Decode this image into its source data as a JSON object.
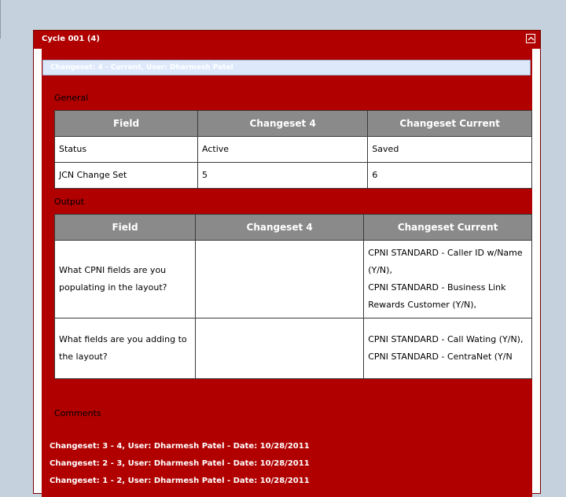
{
  "panel": {
    "title": "Cycle 001 (4)"
  },
  "changeset_bar": "Changeset: 4 - Current, User: Dharmesh Patel",
  "general": {
    "title": "General",
    "columns": [
      "Field",
      "Changeset 4",
      "Changeset Current"
    ],
    "rows": [
      [
        "Status",
        "Active",
        "Saved"
      ],
      [
        "JCN Change Set",
        "5",
        "6"
      ]
    ]
  },
  "output": {
    "title": "Output",
    "columns": [
      "Field",
      "Changeset 4",
      "Changeset Current"
    ],
    "rows": [
      {
        "field": "What CPNI fields are you populating in the layout?",
        "changeset4": "",
        "current": [
          "CPNI STANDARD - Caller ID w/Name (Y/N),",
          "CPNI STANDARD - Business Link Rewards Customer (Y/N),"
        ]
      },
      {
        "field": "What fields are you adding to the layout?",
        "changeset4": "",
        "current": [
          "CPNI STANDARD - Call Wating (Y/N),",
          "CPNI STANDARD - CentraNet (Y/N"
        ]
      }
    ]
  },
  "comments": {
    "title": "Comments",
    "entries": [
      "Changeset: 3 - 4, User: Dharmesh Patel - Date: 10/28/2011",
      "Changeset: 2 - 3, User: Dharmesh Patel - Date: 10/28/2011",
      "Changeset: 1 - 2, User: Dharmesh Patel - Date: 10/28/2011"
    ]
  },
  "colors": {
    "panel_red": "#b00000",
    "header_gray": "#8a8a8a",
    "bar_blue": "#dde9fb",
    "page_bg": "#c5d1dc"
  }
}
